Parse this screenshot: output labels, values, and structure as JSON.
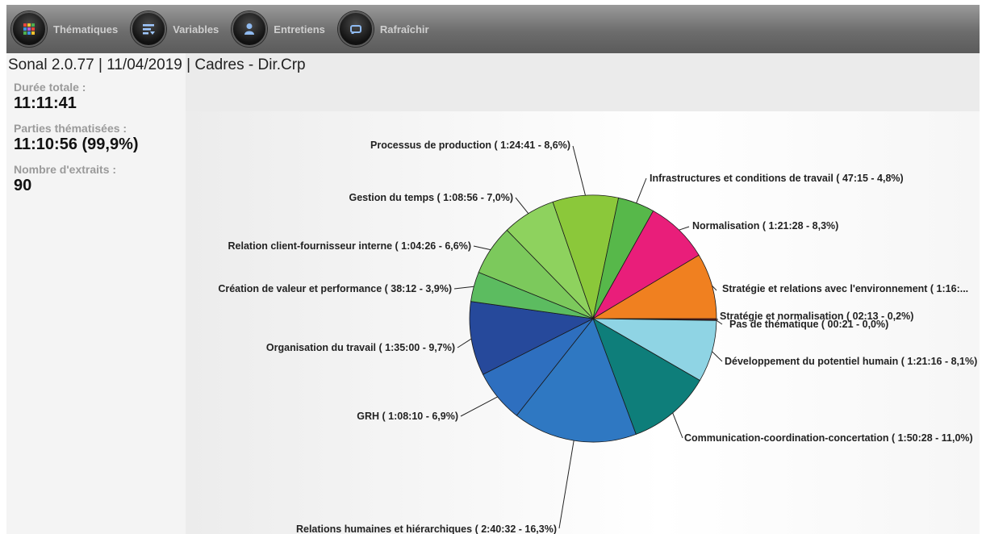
{
  "toolbar": {
    "buttons": [
      {
        "label": "Thématiques",
        "icon": "grid-icon"
      },
      {
        "label": "Variables",
        "icon": "filter-list-icon"
      },
      {
        "label": "Entretiens",
        "icon": "person-icon"
      },
      {
        "label": "Rafraîchir",
        "icon": "refresh-icon"
      }
    ]
  },
  "header": {
    "title": "Sonal 2.0.77 | 11/04/2019 | Cadres - Dir.Crp"
  },
  "stats": {
    "total_label": "Durée totale :",
    "total_value": "11:11:41",
    "themed_label": "Parties thématisées :",
    "themed_value": "11:10:56 (99,9%)",
    "extracts_label": "Nombre d'extraits :",
    "extracts_value": "90"
  },
  "chart_data": {
    "type": "pie",
    "title": "",
    "slices": [
      {
        "label": "Stratégie et normalisation ( 02:13 - 0,2%)",
        "value": 0.2,
        "color": "#7a1a1a"
      },
      {
        "label": "Pas de thématique ( 00:21 - 0,0%)",
        "value": 0.05,
        "color": "#222222"
      },
      {
        "label": "Développement du potentiel humain ( 1:21:16 - 8,1%)",
        "value": 8.1,
        "color": "#8fd4e4"
      },
      {
        "label": "Communication-coordination-concertation ( 1:50:28 - 11,0%)",
        "value": 11.0,
        "color": "#0e7e7a"
      },
      {
        "label": "Relations humaines et hiérarchiques ( 2:40:32 - 16,3%)",
        "value": 16.3,
        "color": "#2f78c2"
      },
      {
        "label": "GRH ( 1:08:10 - 6,9%)",
        "value": 6.9,
        "color": "#2e6fbf"
      },
      {
        "label": "Organisation du travail ( 1:35:00 - 9,7%)",
        "value": 9.7,
        "color": "#26499b"
      },
      {
        "label": "Création de valeur et performance ( 38:12 - 3,9%)",
        "value": 3.9,
        "color": "#5cbc60"
      },
      {
        "label": "Relation client-fournisseur interne ( 1:04:26 - 6,6%)",
        "value": 6.6,
        "color": "#7cc95c"
      },
      {
        "label": "Gestion du temps ( 1:08:56 - 7,0%)",
        "value": 7.0,
        "color": "#8ed25e"
      },
      {
        "label": "Processus de production ( 1:24:41 - 8,6%)",
        "value": 8.6,
        "color": "#8bc83a"
      },
      {
        "label": "Infrastructures et conditions de travail ( 47:15 - 4,8%)",
        "value": 4.8,
        "color": "#57b84a"
      },
      {
        "label": "Normalisation ( 1:21:28 - 8,3%)",
        "value": 8.3,
        "color": "#e91e7a"
      },
      {
        "label": "Stratégie et relations avec l'environnement ( 1:16:...",
        "value": 8.6,
        "color": "#f08020"
      }
    ]
  }
}
